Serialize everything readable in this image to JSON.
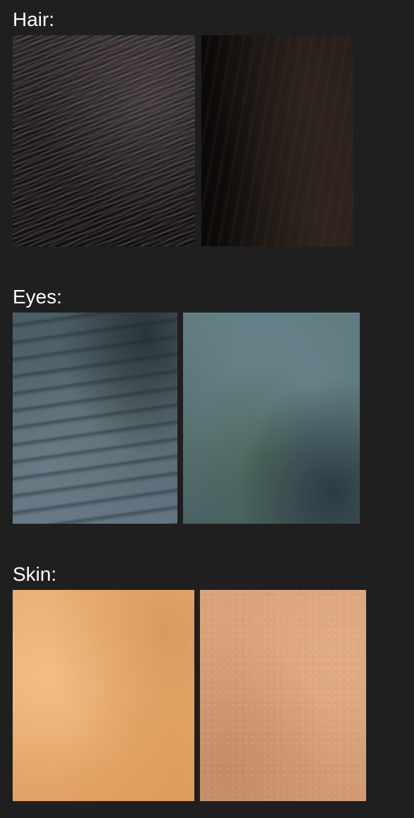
{
  "sections": {
    "hair": {
      "heading": "Hair:"
    },
    "eyes": {
      "heading": "Eyes:"
    },
    "skin": {
      "heading": "Skin:"
    }
  },
  "colors": {
    "background": "#1f1f1f",
    "heading_text": "#ffffff"
  }
}
